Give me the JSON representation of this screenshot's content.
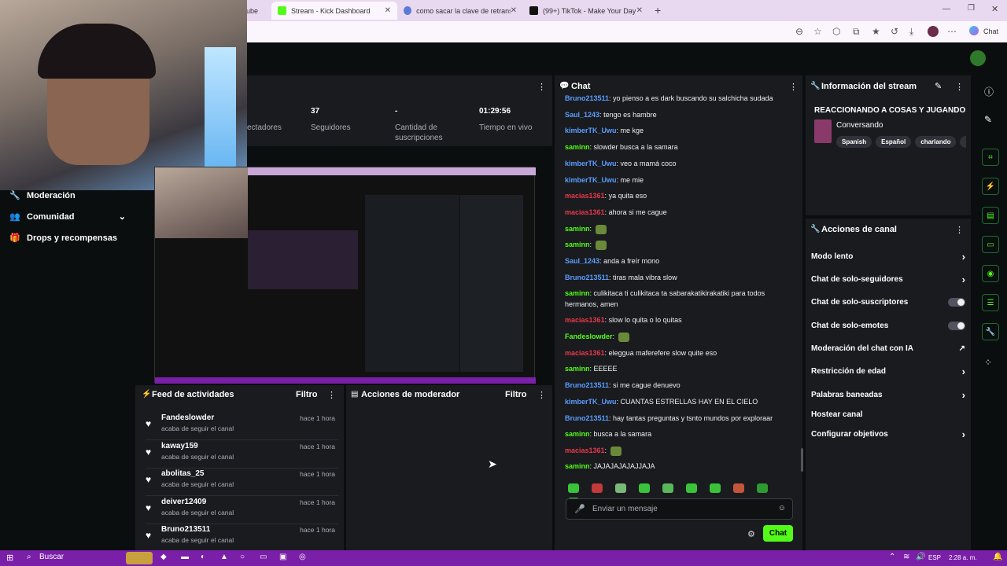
{
  "browser": {
    "tabs": [
      {
        "label": "ube",
        "active": false
      },
      {
        "label": "Stream - Kick Dashboard",
        "active": true
      },
      {
        "label": "como sacar la clave de retransmisió",
        "active": false
      },
      {
        "label": "(99+) TikTok - Make Your Day",
        "active": false
      }
    ],
    "copilot_label": "Chat"
  },
  "stats": [
    {
      "value": "",
      "label": "ectadores"
    },
    {
      "value": "37",
      "label": "Seguidores"
    },
    {
      "value": "-",
      "label": "Cantidad de suscripciones"
    },
    {
      "value": "01:29:56",
      "label": "Tiempo en vivo"
    }
  ],
  "sidebar": {
    "items": [
      {
        "label": "Moderación",
        "icon": "wrench-icon"
      },
      {
        "label": "Comunidad",
        "icon": "people-icon"
      },
      {
        "label": "Drops y recompensas",
        "icon": "gift-icon"
      }
    ]
  },
  "feed": {
    "title": "Feed de actividades",
    "filter_label": "Filtro",
    "items": [
      {
        "user": "Fandeslowder",
        "text": "acaba de seguir el canal",
        "time": "hace 1 hora"
      },
      {
        "user": "kaway159",
        "text": "acaba de seguir el canal",
        "time": "hace 1 hora"
      },
      {
        "user": "abolitas_25",
        "text": "acaba de seguir el canal",
        "time": "hace 1 hora"
      },
      {
        "user": "deiver12409",
        "text": "acaba de seguir el canal",
        "time": "hace 1 hora"
      },
      {
        "user": "Bruno213511",
        "text": "acaba de seguir el canal",
        "time": "hace 1 hora"
      }
    ]
  },
  "mod_actions": {
    "title": "Acciones de moderador",
    "filter_label": "Filtro"
  },
  "chat": {
    "title": "Chat",
    "messages": [
      {
        "user": "Bruno213511",
        "color": "#5b9dff",
        "text": "yo pienso a es dark buscando su salchicha sudada"
      },
      {
        "user": "Saul_1243",
        "color": "#5b9dff",
        "text": "tengo es hambre"
      },
      {
        "user": "kimberTK_Uwu",
        "color": "#5b9dff",
        "text": "me kge"
      },
      {
        "user": "saminn",
        "color": "#53fc18",
        "text": "slowder busca a la samara"
      },
      {
        "user": "kimberTK_Uwu",
        "color": "#5b9dff",
        "text": "veo a mamá coco"
      },
      {
        "user": "kimberTK_Uwu",
        "color": "#5b9dff",
        "text": "me mie"
      },
      {
        "user": "macias1361",
        "color": "#e8394a",
        "text": "ya quita eso"
      },
      {
        "user": "macias1361",
        "color": "#e8394a",
        "text": "ahora si me cague"
      },
      {
        "user": "saminn",
        "color": "#53fc18",
        "text": ""
      },
      {
        "user": "saminn",
        "color": "#53fc18",
        "text": ""
      },
      {
        "user": "Saul_1243",
        "color": "#5b9dff",
        "text": "anda a freír mono"
      },
      {
        "user": "Bruno213511",
        "color": "#5b9dff",
        "text": "tiras mala vibra slow"
      },
      {
        "user": "saminn",
        "color": "#53fc18",
        "text": "culikitaca ti culikitaca ta sabarakatikirakatiki para todos hermanos, amen"
      },
      {
        "user": "macias1361",
        "color": "#e8394a",
        "text": "slow lo quita o lo quitas"
      },
      {
        "user": "Fandeslowder",
        "color": "#53fc18",
        "text": ""
      },
      {
        "user": "macias1361",
        "color": "#e8394a",
        "text": "eleggua maferefere slow quite eso"
      },
      {
        "user": "saminn",
        "color": "#53fc18",
        "text": "EEEEE"
      },
      {
        "user": "Bruno213511",
        "color": "#5b9dff",
        "text": "si me cague denuevo"
      },
      {
        "user": "kimberTK_Uwu",
        "color": "#5b9dff",
        "text": "CUANTAS ESTRELLAS HAY EN EL CIELO"
      },
      {
        "user": "Bruno213511",
        "color": "#5b9dff",
        "text": "hay tantas preguntas y tsnto mundos por exploraar"
      },
      {
        "user": "saminn",
        "color": "#53fc18",
        "text": "busca a la samara"
      },
      {
        "user": "macias1361",
        "color": "#e8394a",
        "text": ""
      },
      {
        "user": "saminn",
        "color": "#53fc18",
        "text": "JAJAJAJAJAJJAJA"
      }
    ],
    "input_placeholder": "Enviar un mensaje",
    "send_label": "Chat"
  },
  "stream_info": {
    "title": "Información del stream",
    "stream_title": "REACCIONANDO A COSAS Y JUGANDO",
    "category": "Conversando",
    "tags": [
      "Spanish",
      "Español",
      "charlando",
      "m"
    ]
  },
  "channel_actions": {
    "title": "Acciones de canal",
    "rows": [
      {
        "label": "Modo lento",
        "control": "chevron"
      },
      {
        "label": "Chat de solo-seguidores",
        "control": "chevron"
      },
      {
        "label": "Chat de solo-suscriptores",
        "control": "toggle"
      },
      {
        "label": "Chat de solo-emotes",
        "control": "toggle"
      },
      {
        "label": "Moderación del chat con IA",
        "control": "external"
      },
      {
        "label": "Restricción de edad",
        "control": "chevron"
      },
      {
        "label": "Palabras baneadas",
        "control": "chevron"
      },
      {
        "label": "Hostear canal",
        "control": "none"
      },
      {
        "label": "Configurar objetivos",
        "control": "chevron"
      }
    ]
  },
  "taskbar": {
    "search_label": "Buscar",
    "lang": "ESP",
    "time": "2:28 a. m."
  },
  "colors": {
    "accent": "#53fc18",
    "panel": "#191b1f",
    "taskbar": "#7a1fa8"
  }
}
